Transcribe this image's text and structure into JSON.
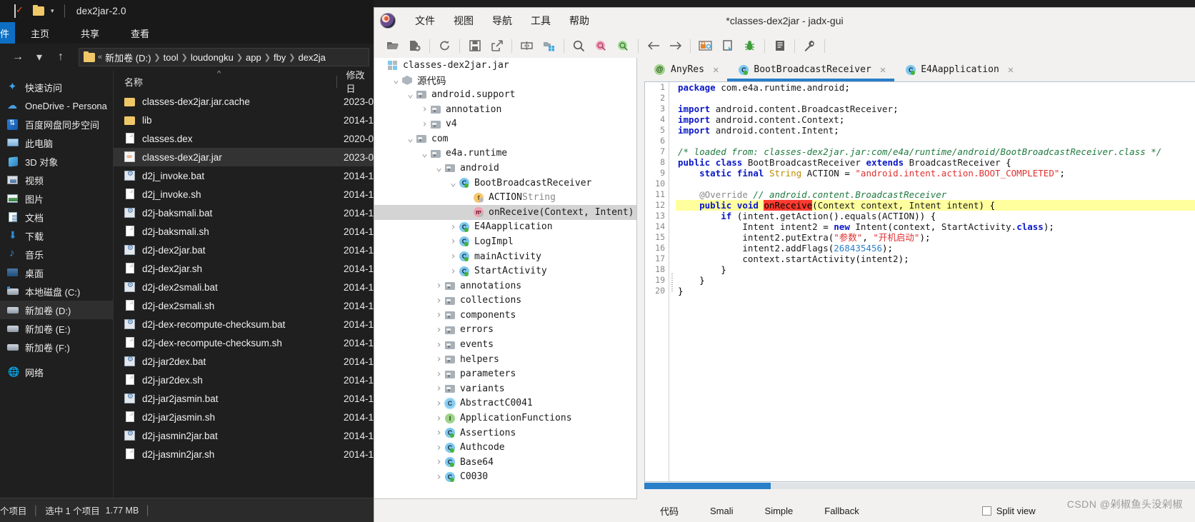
{
  "explorer": {
    "titlebar": {
      "title": "dex2jar-2.0",
      "quick_access_icon": "checkbox-doc-icon",
      "folder_icon": "folder-icon",
      "dropdown_icon": "chevron-down-icon"
    },
    "ribbon": {
      "file_tab": "件",
      "tabs": [
        "主页",
        "共享",
        "查看"
      ]
    },
    "address": {
      "forward_icon": "arrow-right-icon",
      "history_icon": "chevron-down-icon",
      "up_icon": "arrow-up-icon",
      "overflow": "«",
      "crumbs": [
        "新加卷 (D:)",
        "tool",
        "loudongku",
        "app",
        "fby",
        "dex2ja"
      ]
    },
    "nav": {
      "items": [
        {
          "label": "快速访问",
          "icon": "star-icon"
        },
        {
          "label": "OneDrive - Persona",
          "icon": "cloud-icon"
        },
        {
          "label": "百度网盘同步空间",
          "icon": "baidu-netdisk-icon"
        },
        {
          "label": "此电脑",
          "icon": "this-pc-icon"
        },
        {
          "label": "3D 对象",
          "icon": "3d-objects-icon"
        },
        {
          "label": "视频",
          "icon": "videos-icon"
        },
        {
          "label": "图片",
          "icon": "pictures-icon"
        },
        {
          "label": "文档",
          "icon": "documents-icon"
        },
        {
          "label": "下载",
          "icon": "downloads-icon"
        },
        {
          "label": "音乐",
          "icon": "music-icon"
        },
        {
          "label": "桌面",
          "icon": "desktop-icon"
        },
        {
          "label": "本地磁盘 (C:)",
          "icon": "system-drive-icon"
        },
        {
          "label": "新加卷 (D:)",
          "icon": "drive-icon",
          "selected": true
        },
        {
          "label": "新加卷 (E:)",
          "icon": "drive-icon"
        },
        {
          "label": "新加卷 (F:)",
          "icon": "drive-icon"
        },
        {
          "label": "网络",
          "icon": "network-icon"
        }
      ]
    },
    "list": {
      "columns": [
        "名称",
        "修改日"
      ],
      "sort_icon": "chevron-up-icon",
      "rows": [
        {
          "name": "classes-dex2jar.jar.cache",
          "icon": "folder-icon",
          "date": "2023-0"
        },
        {
          "name": "lib",
          "icon": "folder-icon",
          "date": "2014-1"
        },
        {
          "name": "classes.dex",
          "icon": "file-icon",
          "date": "2020-0"
        },
        {
          "name": "classes-dex2jar.jar",
          "icon": "jar-icon",
          "date": "2023-0",
          "selected": true
        },
        {
          "name": "d2j_invoke.bat",
          "icon": "bat-icon",
          "date": "2014-1"
        },
        {
          "name": "d2j_invoke.sh",
          "icon": "file-icon",
          "date": "2014-1"
        },
        {
          "name": "d2j-baksmali.bat",
          "icon": "bat-icon",
          "date": "2014-1"
        },
        {
          "name": "d2j-baksmali.sh",
          "icon": "file-icon",
          "date": "2014-1"
        },
        {
          "name": "d2j-dex2jar.bat",
          "icon": "bat-icon",
          "date": "2014-1"
        },
        {
          "name": "d2j-dex2jar.sh",
          "icon": "file-icon",
          "date": "2014-1"
        },
        {
          "name": "d2j-dex2smali.bat",
          "icon": "bat-icon",
          "date": "2014-1"
        },
        {
          "name": "d2j-dex2smali.sh",
          "icon": "file-icon",
          "date": "2014-1"
        },
        {
          "name": "d2j-dex-recompute-checksum.bat",
          "icon": "bat-icon",
          "date": "2014-1"
        },
        {
          "name": "d2j-dex-recompute-checksum.sh",
          "icon": "file-icon",
          "date": "2014-1"
        },
        {
          "name": "d2j-jar2dex.bat",
          "icon": "bat-icon",
          "date": "2014-1"
        },
        {
          "name": "d2j-jar2dex.sh",
          "icon": "file-icon",
          "date": "2014-1"
        },
        {
          "name": "d2j-jar2jasmin.bat",
          "icon": "bat-icon",
          "date": "2014-1"
        },
        {
          "name": "d2j-jar2jasmin.sh",
          "icon": "file-icon",
          "date": "2014-1"
        },
        {
          "name": "d2j-jasmin2jar.bat",
          "icon": "bat-icon",
          "date": "2014-1"
        },
        {
          "name": "d2j-jasmin2jar.sh",
          "icon": "file-icon",
          "date": "2014-1"
        }
      ]
    },
    "status": {
      "items_text": "个项目",
      "selection_text": "选中 1 个项目",
      "size_text": "1.77 MB"
    }
  },
  "jadx": {
    "title": "*classes-dex2jar - jadx-gui",
    "logo_icon": "jadx-logo-icon",
    "menus": [
      "文件",
      "视图",
      "导航",
      "工具",
      "帮助"
    ],
    "toolbar": [
      {
        "icon": "open-folder-icon"
      },
      {
        "icon": "add-files-icon"
      },
      {
        "icon": "reload-icon"
      },
      {
        "icon": "save-icon"
      },
      {
        "icon": "export-icon"
      },
      {
        "icon": "sync-selection-icon"
      },
      {
        "icon": "flat-packages-icon"
      },
      {
        "icon": "search-icon"
      },
      {
        "icon": "search-back-icon"
      },
      {
        "icon": "search-forward-icon"
      },
      {
        "icon": "back-arrow-icon"
      },
      {
        "icon": "forward-arrow-icon"
      },
      {
        "icon": "deobfuscation-icon"
      },
      {
        "icon": "quark-icon"
      },
      {
        "icon": "debugger-icon"
      },
      {
        "icon": "logs-icon"
      },
      {
        "icon": "preferences-icon"
      }
    ],
    "tree": [
      {
        "depth": 0,
        "twist": "",
        "icon": "jar-package-icon",
        "label": "classes-dex2jar.jar"
      },
      {
        "depth": 1,
        "twist": "v",
        "icon": "source-code-icon",
        "label": "源代码",
        "cjk": true
      },
      {
        "depth": 2,
        "twist": "v",
        "icon": "package-icon",
        "label": "android.support"
      },
      {
        "depth": 3,
        "twist": ">",
        "icon": "package-icon",
        "label": "annotation"
      },
      {
        "depth": 3,
        "twist": ">",
        "icon": "package-icon",
        "label": "v4"
      },
      {
        "depth": 2,
        "twist": "v",
        "icon": "package-icon",
        "label": "com"
      },
      {
        "depth": 3,
        "twist": "v",
        "icon": "package-icon",
        "label": "e4a.runtime"
      },
      {
        "depth": 4,
        "twist": "v",
        "icon": "package-icon",
        "label": "android"
      },
      {
        "depth": 5,
        "twist": "v",
        "icon": "class-icon",
        "label": "BootBroadcastReceiver"
      },
      {
        "depth": 6,
        "twist": "",
        "icon": "field-icon",
        "label": "ACTION",
        "suffix": "String"
      },
      {
        "depth": 6,
        "twist": "",
        "icon": "method-icon",
        "label": "onReceive(Context, Intent)",
        "selected": true
      },
      {
        "depth": 5,
        "twist": ">",
        "icon": "class-icon",
        "label": "E4Aapplication"
      },
      {
        "depth": 5,
        "twist": ">",
        "icon": "class-icon",
        "label": "LogImpl"
      },
      {
        "depth": 5,
        "twist": ">",
        "icon": "class-icon",
        "label": "mainActivity"
      },
      {
        "depth": 5,
        "twist": ">",
        "icon": "class-icon",
        "label": "StartActivity"
      },
      {
        "depth": 4,
        "twist": ">",
        "icon": "package-icon",
        "label": "annotations"
      },
      {
        "depth": 4,
        "twist": ">",
        "icon": "package-icon",
        "label": "collections"
      },
      {
        "depth": 4,
        "twist": ">",
        "icon": "package-icon",
        "label": "components"
      },
      {
        "depth": 4,
        "twist": ">",
        "icon": "package-icon",
        "label": "errors"
      },
      {
        "depth": 4,
        "twist": ">",
        "icon": "package-icon",
        "label": "events"
      },
      {
        "depth": 4,
        "twist": ">",
        "icon": "package-icon",
        "label": "helpers"
      },
      {
        "depth": 4,
        "twist": ">",
        "icon": "package-icon",
        "label": "parameters"
      },
      {
        "depth": 4,
        "twist": ">",
        "icon": "package-icon",
        "label": "variants"
      },
      {
        "depth": 4,
        "twist": ">",
        "icon": "abstract-class-icon",
        "label": "AbstractC0041"
      },
      {
        "depth": 4,
        "twist": ">",
        "icon": "interface-icon",
        "label": "ApplicationFunctions"
      },
      {
        "depth": 4,
        "twist": ">",
        "icon": "class-icon",
        "label": "Assertions"
      },
      {
        "depth": 4,
        "twist": ">",
        "icon": "class-icon",
        "label": "Authcode"
      },
      {
        "depth": 4,
        "twist": ">",
        "icon": "class-icon",
        "label": "Base64"
      },
      {
        "depth": 4,
        "twist": ">",
        "icon": "class-icon",
        "label": "C0030"
      }
    ],
    "tabs": [
      {
        "label": "AnyRes",
        "icon": "anyres-icon",
        "active": false,
        "close_icon": "close-icon"
      },
      {
        "label": "BootBroadcastReceiver",
        "icon": "class-icon",
        "active": true,
        "close_icon": "close-icon"
      },
      {
        "label": "E4Aapplication",
        "icon": "class-icon",
        "active": false,
        "close_icon": "close-icon"
      }
    ],
    "code": {
      "line_count": 20,
      "highlight_line": 12,
      "highlight_word": "onReceive",
      "lines": [
        "package com.e4a.runtime.android;",
        "",
        "import android.content.BroadcastReceiver;",
        "import android.content.Context;",
        "import android.content.Intent;",
        "",
        "/* loaded from: classes-dex2jar.jar:com/e4a/runtime/android/BootBroadcastReceiver.class */",
        "public class BootBroadcastReceiver extends BroadcastReceiver {",
        "    static final String ACTION = \"android.intent.action.BOOT_COMPLETED\";",
        "",
        "    @Override // android.content.BroadcastReceiver",
        "    public void onReceive(Context context, Intent intent) {",
        "        if (intent.getAction().equals(ACTION)) {",
        "            Intent intent2 = new Intent(context, StartActivity.class);",
        "            intent2.putExtra(\"参数\", \"开机启动\");",
        "            intent2.addFlags(268435456);",
        "            context.startActivity(intent2);",
        "        }",
        "    }",
        "}"
      ]
    },
    "bottom": {
      "tabs": [
        "代码",
        "Smali",
        "Simple",
        "Fallback"
      ],
      "split_view_label": "Split view",
      "split_view_checked": false
    }
  },
  "watermark": {
    "text": "CSDN @剁椒鱼头没剁椒"
  }
}
